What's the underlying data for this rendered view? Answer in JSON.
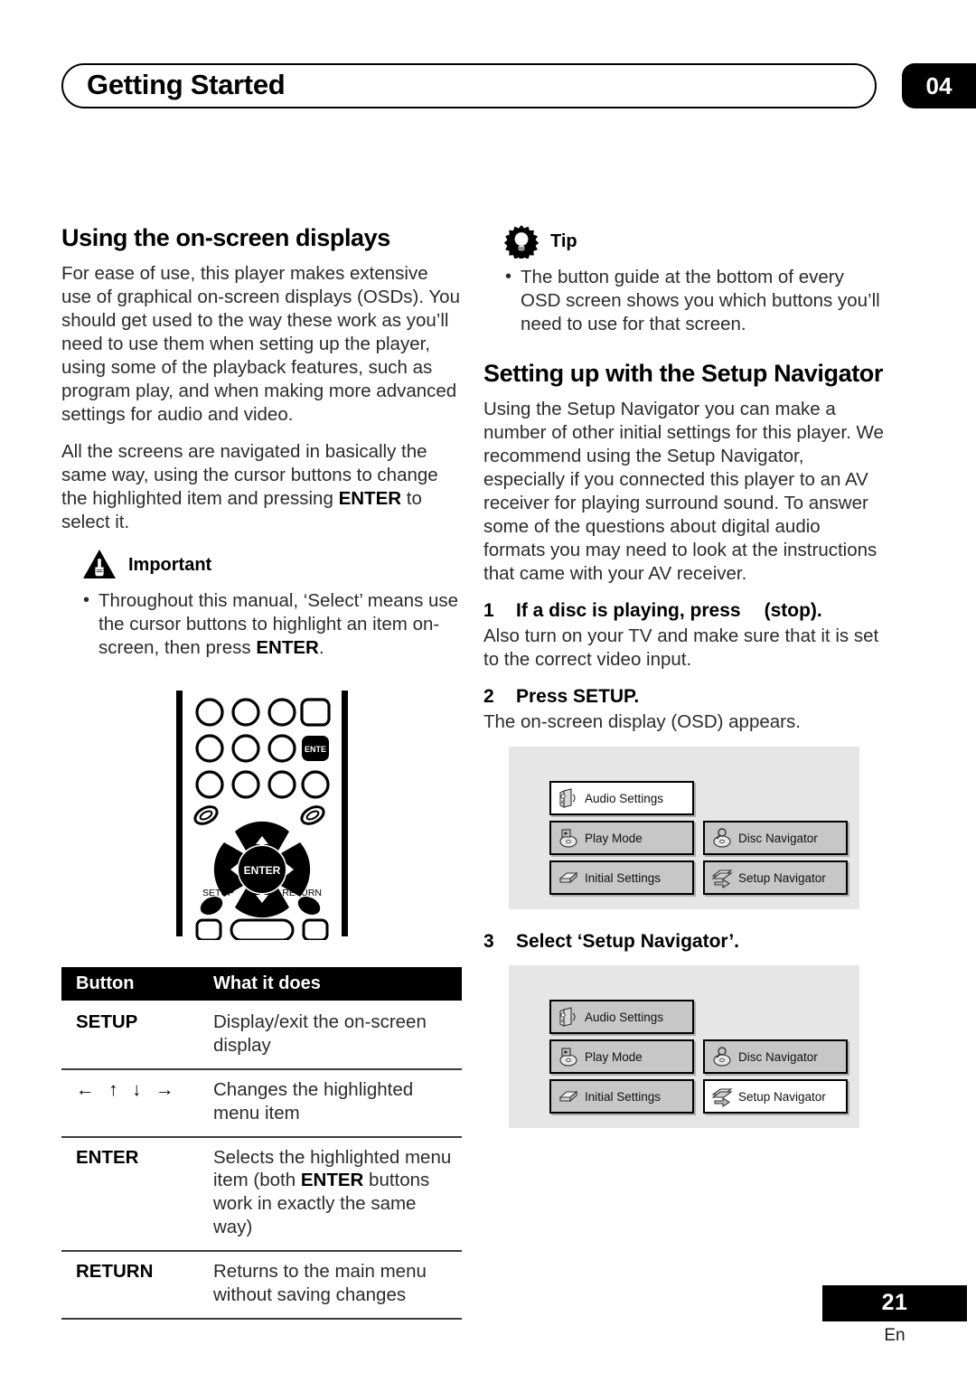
{
  "header": {
    "title": "Getting Started",
    "chapter": "04"
  },
  "left": {
    "section_title": "Using the on-screen displays",
    "para1": "For ease of use, this player makes extensive use of graphical on-screen displays (OSDs). You should get used to the way these work as you’ll need to use them when setting up the player, using some of the playback features, such as program play, and when making more advanced settings for audio and video.",
    "para2_a": "All the screens are navigated in basically the same way, using the cursor buttons to change the highlighted item and pressing ",
    "para2_bold": "ENTER",
    "para2_b": " to select it.",
    "important": {
      "label": "Important",
      "bullet_dot": "•",
      "bullet_a": "Throughout this manual, ‘Select’ means use the cursor buttons to highlight an item on-screen, then press ",
      "bullet_bold": "ENTER",
      "bullet_b": "."
    },
    "remote": {
      "enter_key_label": "ENTE",
      "dpad_center_label": "ENTER",
      "setup_label": "SETUP",
      "return_label": "RETURN"
    },
    "table": {
      "headers": [
        "Button",
        "What it does"
      ],
      "rows": [
        {
          "button": "SETUP",
          "arrows": null,
          "desc_a": "Display/exit the on-screen display",
          "desc_bold": "",
          "desc_b": ""
        },
        {
          "button": "",
          "arrows": "← ↑ ↓ →",
          "desc_a": "Changes the highlighted menu item",
          "desc_bold": "",
          "desc_b": ""
        },
        {
          "button": "ENTER",
          "arrows": null,
          "desc_a": "Selects the highlighted menu item (both ",
          "desc_bold": "ENTER",
          "desc_b": " buttons work in exactly the same way)"
        },
        {
          "button": "RETURN",
          "arrows": null,
          "desc_a": "Returns to the main menu without saving changes",
          "desc_bold": "",
          "desc_b": ""
        }
      ]
    }
  },
  "right": {
    "tip": {
      "label": "Tip",
      "bullet_dot": "•",
      "bullet": "The button guide at the bottom of every OSD screen shows you which buttons you’ll need to use for that screen."
    },
    "section_title": "Setting up with the Setup Navigator",
    "para1": "Using the Setup Navigator you can make a number of other initial settings for this player. We recommend using the Setup Navigator, especially if you connected this player to an AV receiver for playing surround sound. To answer some of the questions about digital audio formats you may need to look at the instructions that came with your AV receiver.",
    "steps": [
      {
        "num": "1",
        "head_a": "If a disc is playing, press",
        "head_glyph": "",
        "head_b": "(stop).",
        "body": "Also turn on your TV and make sure that it is set to the correct video input."
      },
      {
        "num": "2",
        "head_a": "Press SETUP.",
        "head_glyph": "",
        "head_b": "",
        "body": "The on-screen display (OSD) appears."
      },
      {
        "num": "3",
        "head_a": "Select ‘Setup Navigator’.",
        "head_glyph": "",
        "head_b": "",
        "body": ""
      }
    ],
    "osd1": {
      "items": [
        {
          "label": "Audio Settings",
          "icon": "speaker-icon",
          "selected": true
        },
        {
          "label": "Play Mode",
          "icon": "play-mode-icon",
          "selected": false
        },
        {
          "label": "Disc Navigator",
          "icon": "disc-navigator-icon",
          "selected": false
        },
        {
          "label": "Initial Settings",
          "icon": "initial-settings-icon",
          "selected": false
        },
        {
          "label": "Setup Navigator",
          "icon": "setup-navigator-icon",
          "selected": false
        }
      ]
    },
    "osd2": {
      "items": [
        {
          "label": "Audio Settings",
          "icon": "speaker-icon",
          "selected": false
        },
        {
          "label": "Play Mode",
          "icon": "play-mode-icon",
          "selected": false
        },
        {
          "label": "Disc Navigator",
          "icon": "disc-navigator-icon",
          "selected": false
        },
        {
          "label": "Initial Settings",
          "icon": "initial-settings-icon",
          "selected": false
        },
        {
          "label": "Setup Navigator",
          "icon": "setup-navigator-icon",
          "selected": true
        }
      ]
    }
  },
  "footer": {
    "page": "21",
    "language": "En"
  },
  "colors": {
    "ink": "#000000",
    "body_text": "#2b2b2b",
    "osd_bg": "#e6e6e6",
    "osd_item": "#c7c7c7",
    "osd_selected": "#ffffff"
  }
}
